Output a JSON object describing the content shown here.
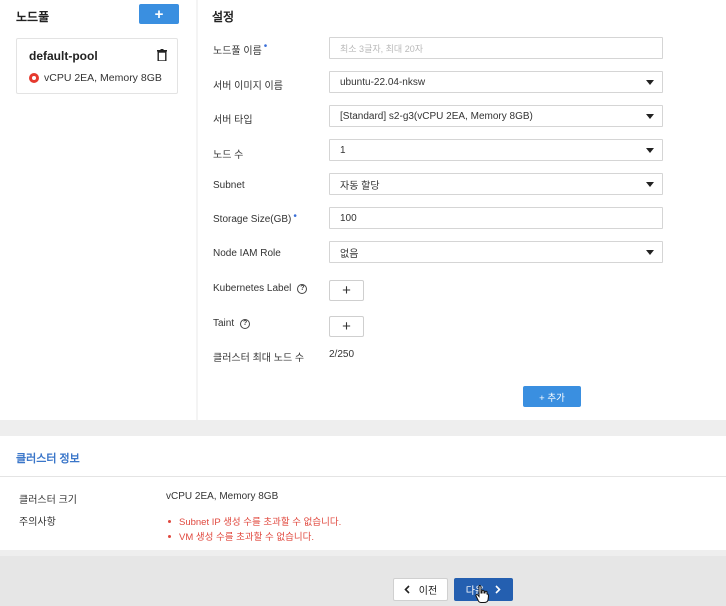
{
  "left_panel": {
    "title": "노드풀",
    "add_button": "+",
    "pool": {
      "name": "default-pool",
      "spec": "vCPU 2EA, Memory 8GB"
    }
  },
  "settings": {
    "title": "설정",
    "fields": {
      "pool_name": {
        "label": "노드풀 이름",
        "placeholder": "최소 3글자, 최대 20자",
        "value": ""
      },
      "server_image": {
        "label": "서버 이미지 이름",
        "value": "ubuntu-22.04-nksw"
      },
      "server_type": {
        "label": "서버 타입",
        "value": "[Standard] s2-g3(vCPU 2EA, Memory 8GB)"
      },
      "node_count": {
        "label": "노드 수",
        "value": "1"
      },
      "subnet": {
        "label": "Subnet",
        "value": "자동 할당"
      },
      "storage_size": {
        "label": "Storage Size(GB)",
        "value": "100"
      },
      "node_iam_role": {
        "label": "Node IAM Role",
        "value": "없음"
      },
      "kubernetes_label": {
        "label": "Kubernetes Label",
        "button": "+"
      },
      "taint": {
        "label": "Taint",
        "button": "+"
      },
      "max_nodes": {
        "label": "클러스터 최대 노드 수",
        "value": "2/250"
      }
    },
    "add_button": "+ 추가"
  },
  "cluster_info": {
    "title": "클러스터 정보",
    "size_label": "클러스터 크기",
    "size_value": "vCPU 2EA, Memory 8GB",
    "warnings_label": "주의사항",
    "warnings": [
      "Subnet IP 생성 수를 초과할 수 없습니다.",
      "VM 생성 수를 초과할 수 없습니다."
    ]
  },
  "footer": {
    "prev_label": "이전",
    "next_label": "다음"
  },
  "colors": {
    "primary": "#3a8fe0",
    "next_button": "#245fb0",
    "warning": "#e0483e",
    "info_title": "#3a76c9"
  }
}
